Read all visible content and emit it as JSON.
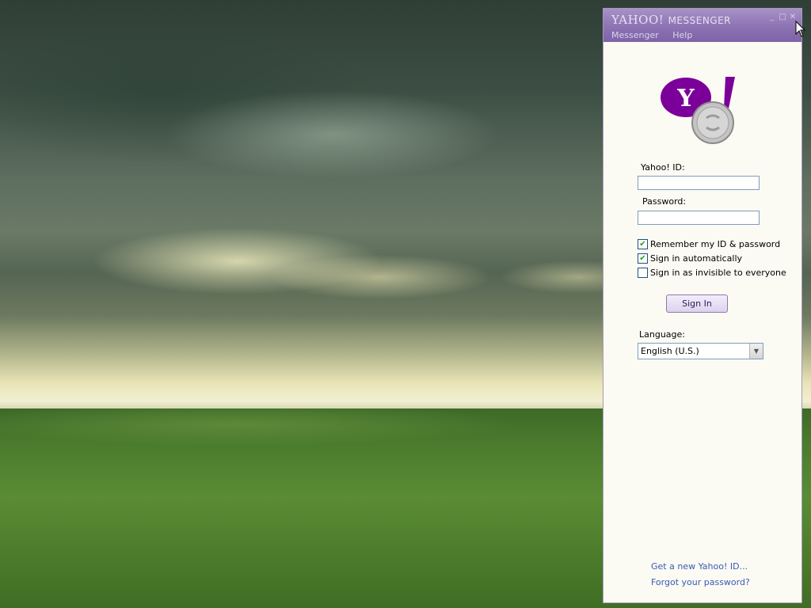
{
  "window": {
    "brand": "YAHOO!",
    "product": "MESSENGER",
    "menu": [
      "Messenger",
      "Help"
    ]
  },
  "form": {
    "id_label": "Yahoo! ID:",
    "id_value": "",
    "password_label": "Password:",
    "password_value": "",
    "remember_label": "Remember my ID & password",
    "remember_checked": true,
    "auto_label": "Sign in automatically",
    "auto_checked": true,
    "invisible_label": "Sign in as invisible to everyone",
    "invisible_checked": false,
    "signin_label": "Sign In",
    "language_label": "Language:",
    "language_value": "English (U.S.)"
  },
  "links": {
    "new_id": "Get a new Yahoo! ID...",
    "forgot": "Forgot your password?"
  },
  "colors": {
    "titlebar": "#8d73b3",
    "logo_purple": "#7b0099",
    "link": "#3b5bb5"
  },
  "icons": {
    "logo": "yahoo-messenger-logo-icon",
    "check": "check-icon",
    "dropdown": "chevron-down-icon",
    "pointer": "mouse-pointer-icon"
  }
}
